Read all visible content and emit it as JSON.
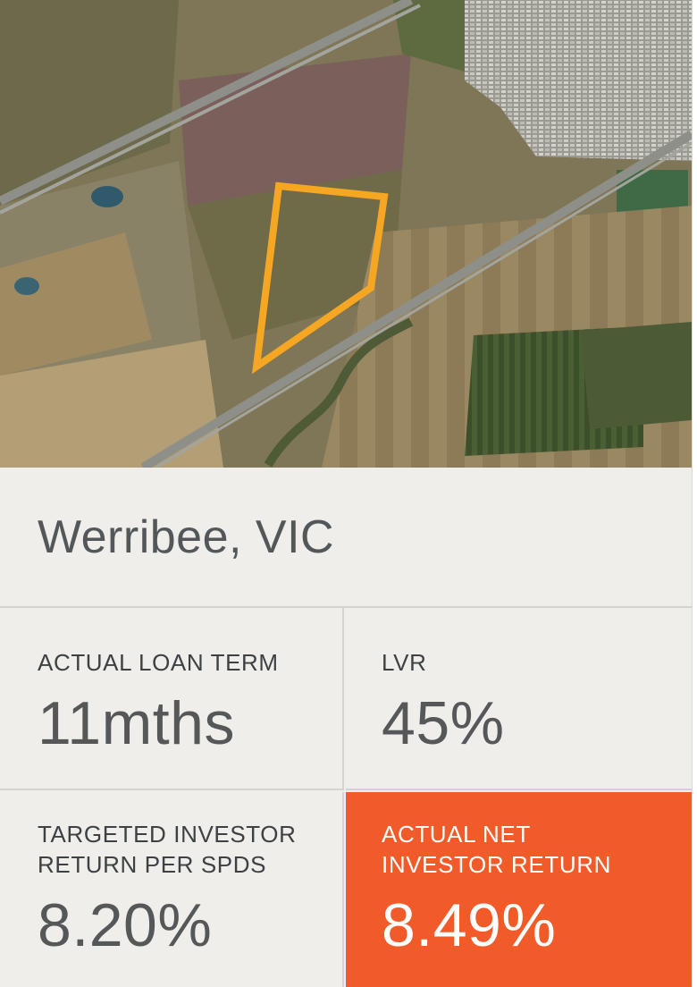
{
  "project": {
    "location": "Werribee, VIC",
    "map_image": "aerial-site-map"
  },
  "stats": {
    "loan_term": {
      "label": "ACTUAL LOAN TERM",
      "value": "11mths"
    },
    "lvr": {
      "label": "LVR",
      "value": "45%"
    },
    "targeted_return": {
      "label": "TARGETED INVESTOR\nRETURN PER SPDS",
      "value": "8.20%"
    },
    "net_return": {
      "label": "ACTUAL NET\nINVESTOR RETURN",
      "value": "8.49%"
    }
  },
  "colors": {
    "highlight": "#f15a29",
    "site_outline": "#f5a623",
    "card_bg": "#efeeeb",
    "text": "#54575a"
  }
}
